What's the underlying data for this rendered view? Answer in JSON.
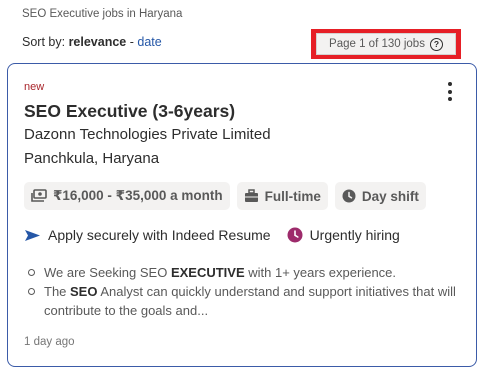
{
  "breadcrumb": "SEO Executive jobs in Haryana",
  "sort": {
    "prefix": "Sort by:",
    "active": "relevance",
    "separator": "-",
    "alternate": "date"
  },
  "pagination": {
    "text": "Page 1 of 130 jobs",
    "help_glyph": "?"
  },
  "job": {
    "tag": "new",
    "title": "SEO Executive (3-6years)",
    "company": "Dazonn Technologies Private Limited",
    "location": "Panchkula, Haryana",
    "salary": "₹16,000 - ₹35,000 a month",
    "job_type": "Full-time",
    "shift": "Day shift",
    "apply_text": "Apply securely with Indeed Resume",
    "urgency": "Urgently hiring",
    "snippet": [
      {
        "pre": "We are Seeking SEO ",
        "bold": "EXECUTIVE",
        "post": " with 1+ years experience."
      },
      {
        "pre": "The ",
        "bold": "SEO",
        "post": " Analyst can quickly understand and support initiatives that will contribute to the goals and..."
      }
    ],
    "posted": "1 day ago"
  },
  "icons": {
    "salary": "money-icon",
    "job_type": "briefcase-icon",
    "shift": "clock-icon",
    "apply": "send-arrow-icon",
    "urgency": "clock-icon",
    "menu": "kebab-menu-icon",
    "help": "question-circle-icon"
  },
  "colors": {
    "link": "#2557a7",
    "highlight_box": "#e61f26",
    "card_border": "#3b5ba8",
    "new_tag": "#a9252b",
    "urgent": "#9d2b6b",
    "apply_arrow": "#2557a7"
  }
}
